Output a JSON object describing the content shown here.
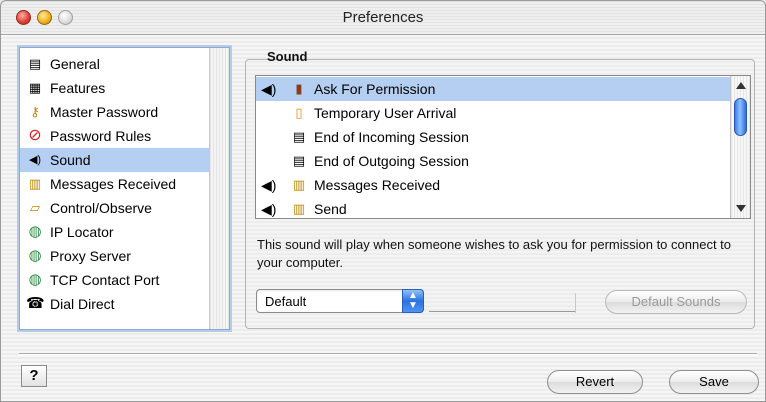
{
  "window": {
    "title": "Preferences"
  },
  "sidebar": {
    "items": [
      {
        "label": "General",
        "icon": "general-icon",
        "glyph": "▤"
      },
      {
        "label": "Features",
        "icon": "features-icon",
        "glyph": "▦"
      },
      {
        "label": "Master Password",
        "icon": "key-icon",
        "glyph": "⚷"
      },
      {
        "label": "Password Rules",
        "icon": "no-sign-icon",
        "glyph": "⊘"
      },
      {
        "label": "Sound",
        "icon": "speaker-icon",
        "glyph": "◀)"
      },
      {
        "label": "Messages Received",
        "icon": "messages-icon",
        "glyph": "▥"
      },
      {
        "label": "Control/Observe",
        "icon": "control-icon",
        "glyph": "▱"
      },
      {
        "label": "IP Locator",
        "icon": "globe-icon",
        "glyph": "◍"
      },
      {
        "label": "Proxy Server",
        "icon": "globe-icon",
        "glyph": "◍"
      },
      {
        "label": "TCP Contact Port",
        "icon": "globe-icon",
        "glyph": "◍"
      },
      {
        "label": "Dial Direct",
        "icon": "phone-icon",
        "glyph": "☎"
      }
    ],
    "selected": "Sound"
  },
  "sound": {
    "group_label": "Sound",
    "events": [
      {
        "label": "Ask For Permission",
        "has_sound": true,
        "icon": "door-icon",
        "glyph": "▮"
      },
      {
        "label": "Temporary User Arrival",
        "has_sound": false,
        "icon": "door-open-icon",
        "glyph": "▯"
      },
      {
        "label": "End of Incoming Session",
        "has_sound": false,
        "icon": "session-icon",
        "glyph": "▤"
      },
      {
        "label": "End of Outgoing Session",
        "has_sound": false,
        "icon": "session-icon",
        "glyph": "▤"
      },
      {
        "label": "Messages Received",
        "has_sound": true,
        "icon": "messages-icon",
        "glyph": "▥"
      },
      {
        "label": "Send",
        "has_sound": true,
        "icon": "messages-icon",
        "glyph": "▥"
      }
    ],
    "speaker_glyph": "◀)",
    "description": "This sound will play when someone wishes to ask you for permission to connect to your computer.",
    "popup_value": "Default",
    "default_sounds_label": "Default Sounds"
  },
  "footer": {
    "help_label": "?",
    "revert_label": "Revert",
    "save_label": "Save"
  },
  "colors": {
    "selection": "#b5cff2",
    "accent": "#2b72de"
  }
}
